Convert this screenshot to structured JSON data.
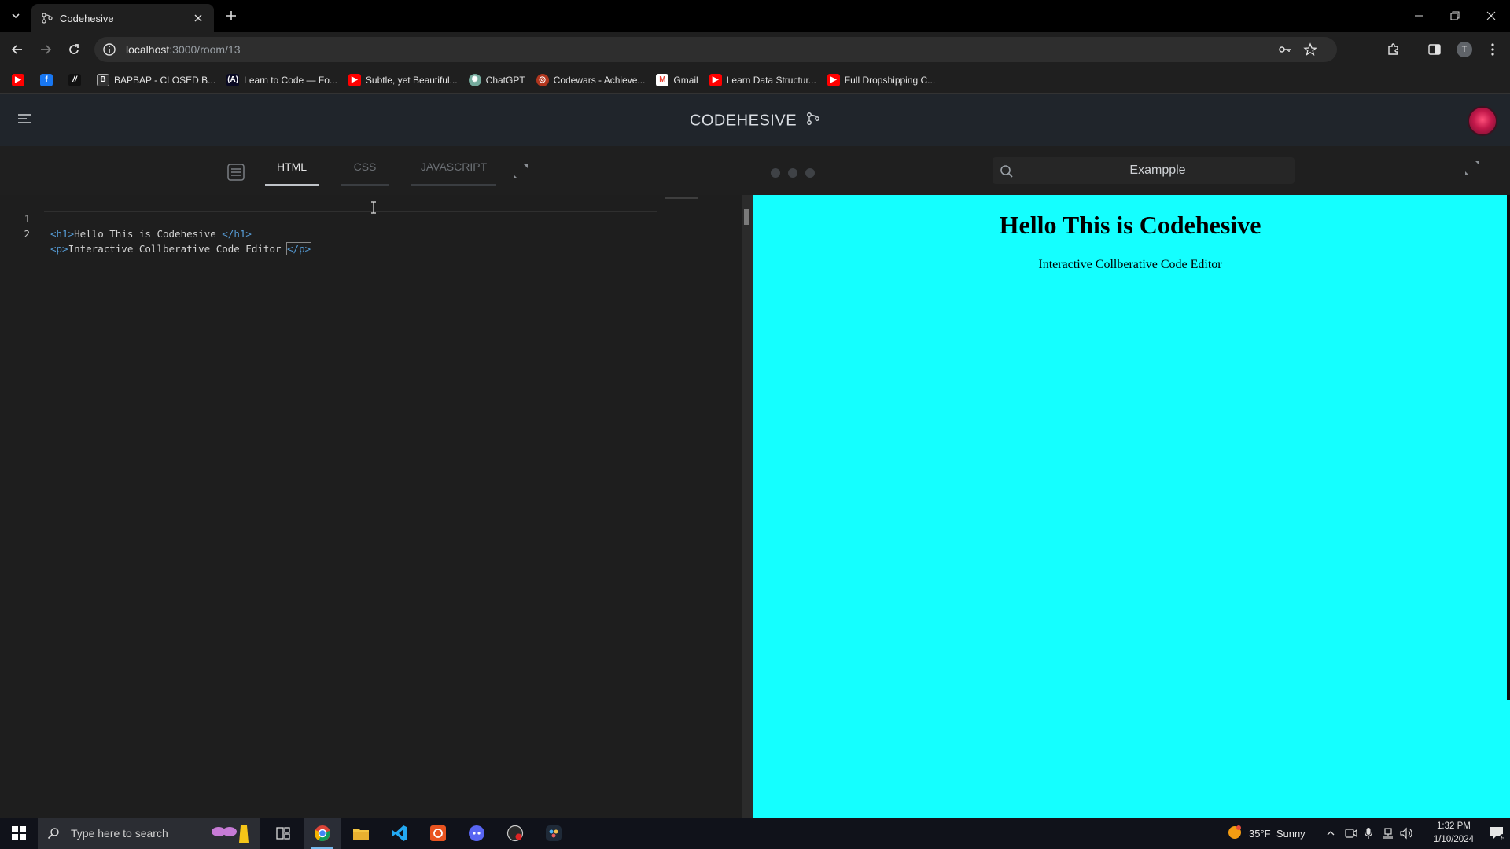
{
  "browser": {
    "tab_title": "Codehesive",
    "url_host": "localhost",
    "url_path": ":3000/room/13",
    "profile_initial": "T"
  },
  "bookmarks": [
    {
      "label": "",
      "icon": "youtube-icon"
    },
    {
      "label": "",
      "icon": "facebook-icon"
    },
    {
      "label": "",
      "icon": "slash-icon"
    },
    {
      "label": "BAPBAP - CLOSED B...",
      "icon": "bapbap-icon"
    },
    {
      "label": "Learn to Code — Fo...",
      "icon": "freecodecamp-icon"
    },
    {
      "label": "Subtle, yet Beautiful...",
      "icon": "youtube-icon"
    },
    {
      "label": "ChatGPT",
      "icon": "chatgpt-icon"
    },
    {
      "label": "Codewars - Achieve...",
      "icon": "codewars-icon"
    },
    {
      "label": "Gmail",
      "icon": "gmail-icon"
    },
    {
      "label": "Learn Data Structur...",
      "icon": "youtube-icon"
    },
    {
      "label": "Full Dropshipping C...",
      "icon": "youtube-icon"
    }
  ],
  "app": {
    "brand": "CODEHESIVE",
    "tabs": [
      "HTML",
      "CSS",
      "JAVASCRIPT"
    ],
    "active_tab": "HTML",
    "search_value": "Exampple"
  },
  "editor": {
    "lines": [
      {
        "num": "1",
        "open": "<h1>",
        "text": "Hello This is Codehesive ",
        "close": "</h1>"
      },
      {
        "num": "2",
        "open": "<p>",
        "text": "Interactive Collberative Code Editor ",
        "close": "</p>"
      }
    ]
  },
  "preview": {
    "heading": "Hello This is Codehesive",
    "paragraph": "Interactive Collberative Code Editor",
    "background": "#14ffff"
  },
  "taskbar": {
    "search_placeholder": "Type here to search",
    "weather": "35°F  Sunny",
    "time": "1:32 PM",
    "date": "1/10/2024",
    "notifications": "5"
  },
  "colors": {
    "accent_tag": "#569cd6",
    "header_bg": "#20252b"
  }
}
